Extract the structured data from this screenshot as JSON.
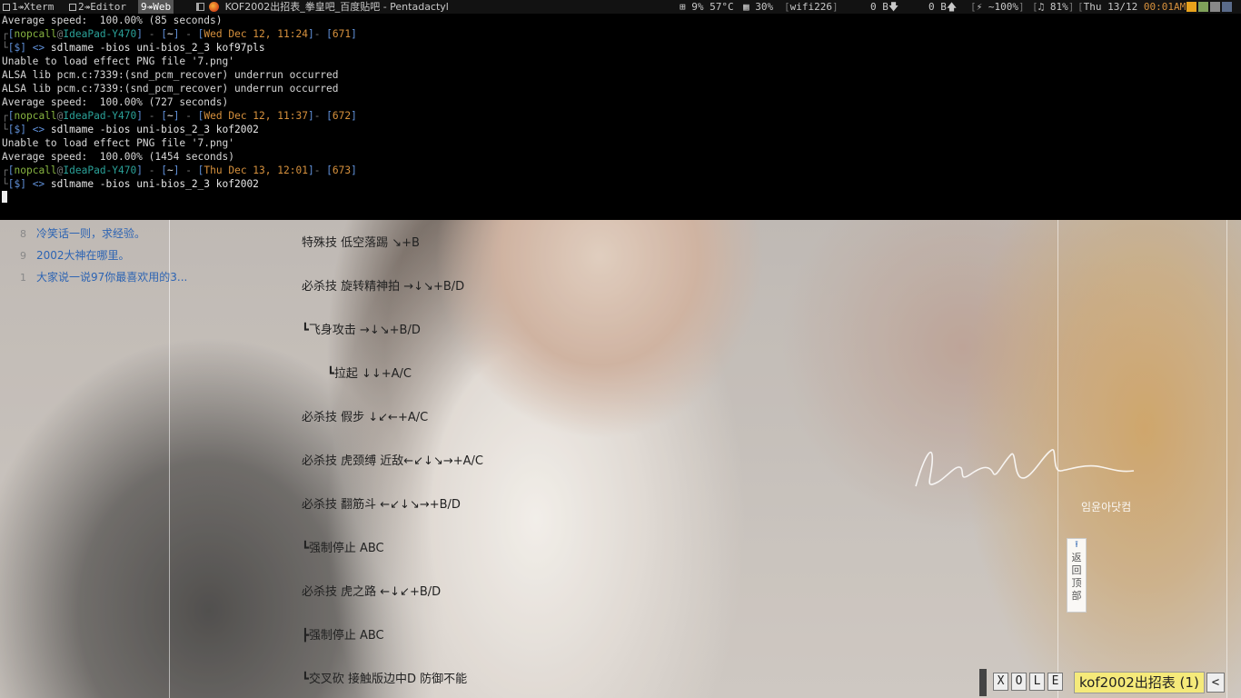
{
  "statusbar": {
    "workspaces": [
      {
        "label": "1↠Xterm"
      },
      {
        "label": "2↠Editor"
      },
      {
        "label": "9↠Web"
      }
    ],
    "window_title": "KOF2002出招表_拳皇吧_百度贴吧 - Pentadactyl",
    "cpu": "9%",
    "temp": "57°C",
    "mem": "30%",
    "wifi": "wifi226",
    "down": "0 B",
    "up": "0 B",
    "power": "~100%",
    "volume": "81%",
    "datetime": "Thu 13/12 ",
    "time": "00:01AM"
  },
  "terminal": {
    "user": "nopcall",
    "host": "IdeaPad-Y470",
    "cwd": "~",
    "lines_top": [
      "Average speed:  100.00% (85 seconds)"
    ],
    "blocks": [
      {
        "date": "Wed Dec 12, 11:24",
        "num": "671",
        "command": "sdlmame -bios uni-bios_2_3 kof97pls",
        "output": [
          "Unable to load effect PNG file '7.png'",
          "ALSA lib pcm.c:7339:(snd_pcm_recover) underrun occurred",
          "ALSA lib pcm.c:7339:(snd_pcm_recover) underrun occurred",
          "Average speed:  100.00% (727 seconds)"
        ]
      },
      {
        "date": "Wed Dec 12, 11:37",
        "num": "672",
        "command": "sdlmame -bios uni-bios_2_3 kof2002",
        "output": [
          "Unable to load effect PNG file '7.png'",
          "Average speed:  100.00% (1454 seconds)"
        ]
      },
      {
        "date": "Thu Dec 13, 12:01",
        "num": "673",
        "command": "sdlmame -bios uni-bios_2_3 kof2002",
        "output": []
      }
    ]
  },
  "sidebar": {
    "items": [
      {
        "num": "8",
        "text": "冷笑话一则，求经验。"
      },
      {
        "num": "9",
        "text": "2002大神在哪里。"
      },
      {
        "num": "1",
        "text": "大家说一说97你最喜欢用的3..."
      }
    ]
  },
  "moves": [
    {
      "tree": "",
      "text": "特殊技 低空落踢 ↘+B",
      "indent": false
    },
    {
      "tree": "",
      "text": "必杀技 旋转精神拍 →↓↘+B/D",
      "indent": false
    },
    {
      "tree": "┗",
      "text": "飞身攻击 →↓↘+B/D",
      "indent": false
    },
    {
      "tree": "┗",
      "text": "拉起 ↓↓+A/C",
      "indent": true
    },
    {
      "tree": "",
      "text": "必杀技 假步 ↓↙←+A/C",
      "indent": false
    },
    {
      "tree": "",
      "text": "必杀技 虎颈缚 近敌←↙↓↘→+A/C",
      "indent": false
    },
    {
      "tree": "",
      "text": "必杀技 翻筋斗 ←↙↓↘→+B/D",
      "indent": false
    },
    {
      "tree": "┗",
      "text": "强制停止 ABC",
      "indent": false
    },
    {
      "tree": "",
      "text": "必杀技 虎之路 ←↓↙+B/D",
      "indent": false
    },
    {
      "tree": "┣",
      "text": "强制停止 ABC",
      "indent": false
    },
    {
      "tree": "┗",
      "text": "交叉砍 接触版边中D 防御不能",
      "indent": false
    }
  ],
  "back_to_top": {
    "label": "返回顶部"
  },
  "watermark": {
    "korean": "임윤아닷컴"
  },
  "dactyl": {
    "buttons": [
      "X",
      "O",
      "L",
      "E"
    ],
    "tab_title": "kof2002出招表 (1)",
    "prev": "<"
  }
}
